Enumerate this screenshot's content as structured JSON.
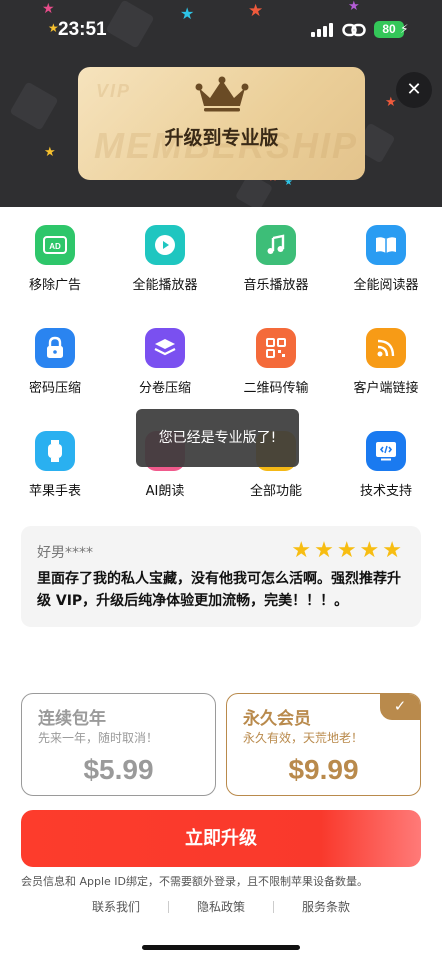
{
  "status_bar": {
    "time": "23:51",
    "battery": "80"
  },
  "banner": {
    "title": "升级到专业版",
    "watermark_small": "VIP",
    "watermark_big": "MEMBERSHIP"
  },
  "features": [
    {
      "label": "移除广告",
      "icon": "ad-icon",
      "color": "#2ec66a"
    },
    {
      "label": "全能播放器",
      "icon": "play-icon",
      "color": "#1fc6c0"
    },
    {
      "label": "音乐播放器",
      "icon": "music-icon",
      "color": "#3dbe78"
    },
    {
      "label": "全能阅读器",
      "icon": "book-icon",
      "color": "#2a9cf2"
    },
    {
      "label": "密码压缩",
      "icon": "lock-icon",
      "color": "#2a84f0"
    },
    {
      "label": "分卷压缩",
      "icon": "layers-icon",
      "color": "#7a50f0"
    },
    {
      "label": "二维码传输",
      "icon": "qrcode-icon",
      "color": "#f46a3a"
    },
    {
      "label": "客户端链接",
      "icon": "rss-icon",
      "color": "#f79b16"
    },
    {
      "label": "苹果手表",
      "icon": "watch-icon",
      "color": "#2ab0f0"
    },
    {
      "label": "AI朗读",
      "icon": "ai-voice-icon",
      "color": "#f05a8c"
    },
    {
      "label": "全部功能",
      "icon": "grid-icon",
      "color": "#f4b816"
    },
    {
      "label": "技术支持",
      "icon": "code-icon",
      "color": "#1a7af0"
    }
  ],
  "toast": "您已经是专业版了!",
  "review": {
    "reviewer": "好男****",
    "rating": 5,
    "text": "里面存了我的私人宝藏，没有他我可怎么活啊。强烈推荐升级 VIP，升级后纯净体验更加流畅，完美！！！。"
  },
  "plans": {
    "annual": {
      "name": "连续包年",
      "subtitle": "先来一年，随时取消！",
      "price": "$5.99"
    },
    "lifetime": {
      "name": "永久会员",
      "subtitle": "永久有效，天荒地老！",
      "price": "$9.99",
      "selected": true
    }
  },
  "upgrade_button": "立即升级",
  "disclaimer": "会员信息和 Apple ID绑定，不需要额外登录，且不限制苹果设备数量。",
  "footer": {
    "contact": "联系我们",
    "privacy": "隐私政策",
    "terms": "服务条款"
  },
  "colors": {
    "accent_red": "#fd3c2c",
    "gold": "#b98a4c",
    "star": "#f7bd12"
  }
}
